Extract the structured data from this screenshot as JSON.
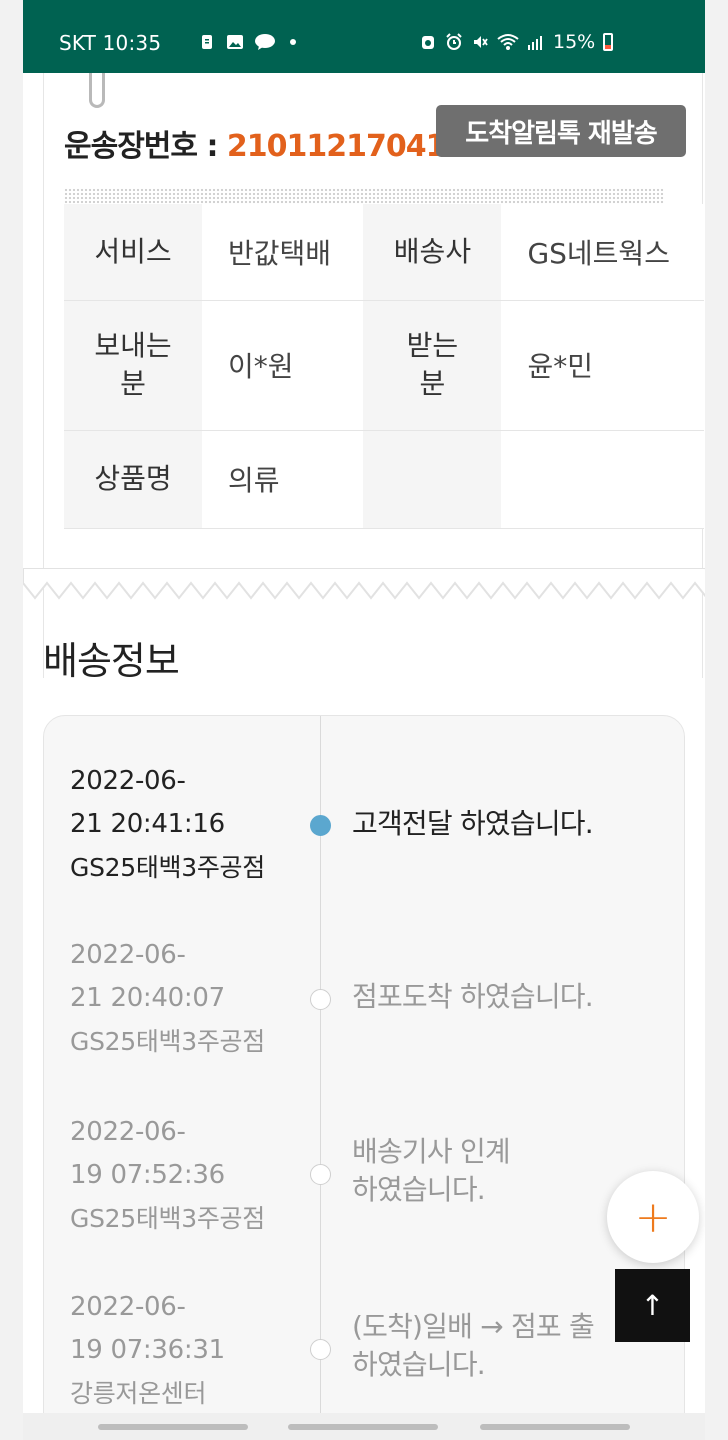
{
  "status_bar": {
    "carrier_time": "SKT 10:35",
    "battery": "15%"
  },
  "shipment": {
    "tracking_label": "운송장번호 : ",
    "tracking_number": "21011217041",
    "resend_button": "도착알림톡 재발송",
    "table": {
      "service_label": "서비스",
      "service_value": "반값택배",
      "courier_label": "배송사",
      "courier_value": "GS네트웍스",
      "sender_label": "보내는 분",
      "sender_value": "이*원",
      "receiver_label": "받는 분",
      "receiver_value": "윤*민",
      "product_label": "상품명",
      "product_value": "의류"
    }
  },
  "delivery": {
    "title": "배송정보",
    "events": [
      {
        "date": "2022-06-",
        "time": "21 20:41:16",
        "location": "GS25태백3주공점",
        "message_line1": "고객전달 하였습니다.",
        "message_line2": ""
      },
      {
        "date": "2022-06-",
        "time": "21 20:40:07",
        "location": "GS25태백3주공점",
        "message_line1": "점포도착 하였습니다.",
        "message_line2": ""
      },
      {
        "date": "2022-06-",
        "time": "19 07:52:36",
        "location": "GS25태백3주공점",
        "message_line1": "배송기사 인계",
        "message_line2": "하였습니다."
      },
      {
        "date": "2022-06-",
        "time": "19 07:36:31",
        "location": "강릉저온센터",
        "message_line1": "(도착)일배 → 점포 출",
        "message_line2": "하였습니다."
      }
    ]
  },
  "fab": {
    "plus": "+",
    "top": "↑"
  },
  "colors": {
    "status_bar": "#006251",
    "accent": "#e2611c",
    "active_dot": "#5ba7cf"
  }
}
